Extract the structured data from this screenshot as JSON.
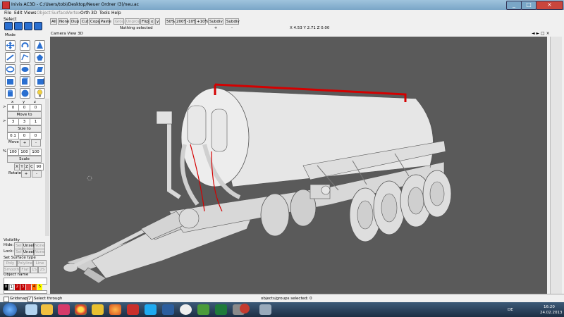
{
  "window": {
    "title": "Inivis AC3D - C:/Users/tobi/Desktop/Neuer Ordner (3)/neu.ac",
    "min": "_",
    "max": "□",
    "close": "×"
  },
  "menu": [
    "File",
    "Edit",
    "Views",
    "Object",
    "Surface",
    "Vertex",
    "Orth",
    "3D",
    "Tools",
    "Help"
  ],
  "menu_dim": [
    "Object",
    "Surface",
    "Vertex"
  ],
  "left": {
    "select_label": "Select",
    "mode_label": "Mode",
    "xyz_headers": [
      "x",
      "y",
      "z"
    ],
    "move_to_vals": [
      "0",
      "0",
      "0"
    ],
    "move_to_btn": "Move to",
    "size_vals": [
      "3",
      "3",
      "1"
    ],
    "size_to_btn": "Size to",
    "move_vals": [
      "0.1",
      "0",
      "0"
    ],
    "move_btn": "Move",
    "move_plus": "+",
    "move_minus": "-",
    "scale_pct": "%",
    "scale_vals": [
      "100",
      "100",
      "100"
    ],
    "scale_btn": "Scale",
    "axis_btns": [
      "X",
      "Y",
      "Z",
      "C"
    ],
    "rotate_val": "90",
    "rotate_btn": "Rotate",
    "rotate_plus": "+",
    "rotate_minus": "-",
    "visibility_label": "Visibility",
    "hide_label": "Hide:",
    "lock_label": "Lock:",
    "vis_btns": [
      "Sel",
      "Unsel",
      "None"
    ],
    "surface_type_label": "Set Surface type",
    "surface_btns": [
      "Poly",
      "Polyline",
      "Line"
    ],
    "smooth_btns": [
      "Smooth",
      "Flat",
      "1S",
      "2S"
    ],
    "object_name_label": "Object name",
    "colors": [
      {
        "num": "0",
        "hex": "#000000"
      },
      {
        "num": "1",
        "hex": "#ffffff"
      },
      {
        "num": "2",
        "hex": "#c00000"
      },
      {
        "num": "3",
        "hex": "#c00000"
      },
      {
        "num": "4",
        "hex": "#ff6600"
      },
      {
        "num": "5",
        "hex": "#ffff00"
      }
    ]
  },
  "toolbar": {
    "buttons": [
      "All",
      "None",
      "Dup",
      "Cut",
      "Copy",
      "Paste",
      "Group",
      "Ungroup",
      "Flip"
    ],
    "dim_buttons": [
      "Group",
      "Ungroup"
    ],
    "zoom_btns": [
      "50%",
      "200%",
      "-10%",
      "+10%"
    ],
    "subdiv_plus": "Subdiv +",
    "subdiv_minus": "Subdiv -",
    "status": "Nothing selected",
    "coords": "X 4.53 Y 2.71 Z 0.00"
  },
  "viewport": {
    "label": "Camera View 3D"
  },
  "statusbar": {
    "gridsnap": "Gridsnap",
    "select_through": "Select through",
    "objects_selected": "objects/groups selected: 0"
  },
  "taskbar": {
    "lang": "DE",
    "time": "16:20",
    "date": "24.02.2013"
  },
  "colors": {
    "viewport_bg": "#5a5a5a",
    "model": "#e8e8e8",
    "red_pipe": "#d40000",
    "panel": "#f0f0f0"
  }
}
